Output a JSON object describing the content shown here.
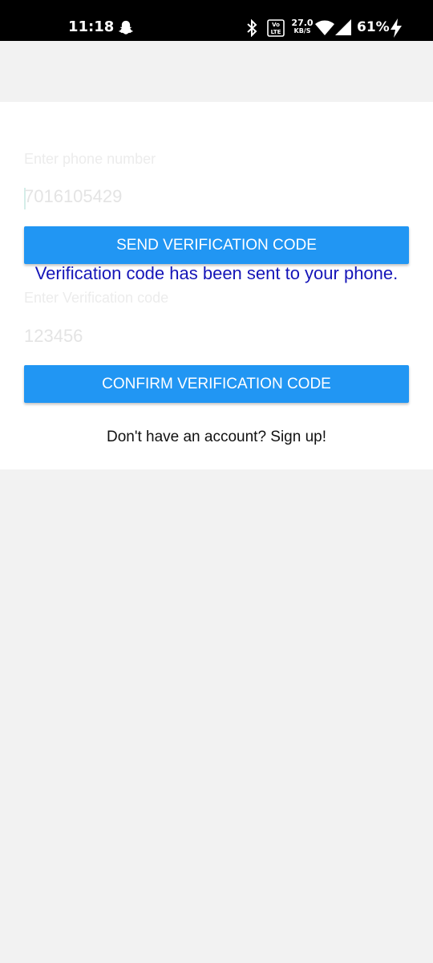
{
  "status_bar": {
    "time": "11:18",
    "volte": "Vo LTE",
    "net_speed_value": "27.0",
    "net_speed_unit": "KB/S",
    "battery": "61%",
    "icons": [
      "snapchat-icon",
      "bluetooth-icon",
      "volte-icon",
      "wifi-icon",
      "signal-icon",
      "charging-icon"
    ]
  },
  "form": {
    "phone_label": "Enter phone number",
    "phone_value": "7016105429",
    "send_button": "SEND VERIFICATION CODE",
    "toast": "Verification code has been sent to your phone.",
    "code_label": "Enter Verification code",
    "code_value": "123456",
    "confirm_button": "CONFIRM VERIFICATION CODE",
    "signup_link": "Don't have an account? Sign up!"
  },
  "colors": {
    "primary": "#2196f3",
    "toast_text": "#1515b8",
    "background": "#f2f2f2",
    "card": "#ffffff"
  }
}
